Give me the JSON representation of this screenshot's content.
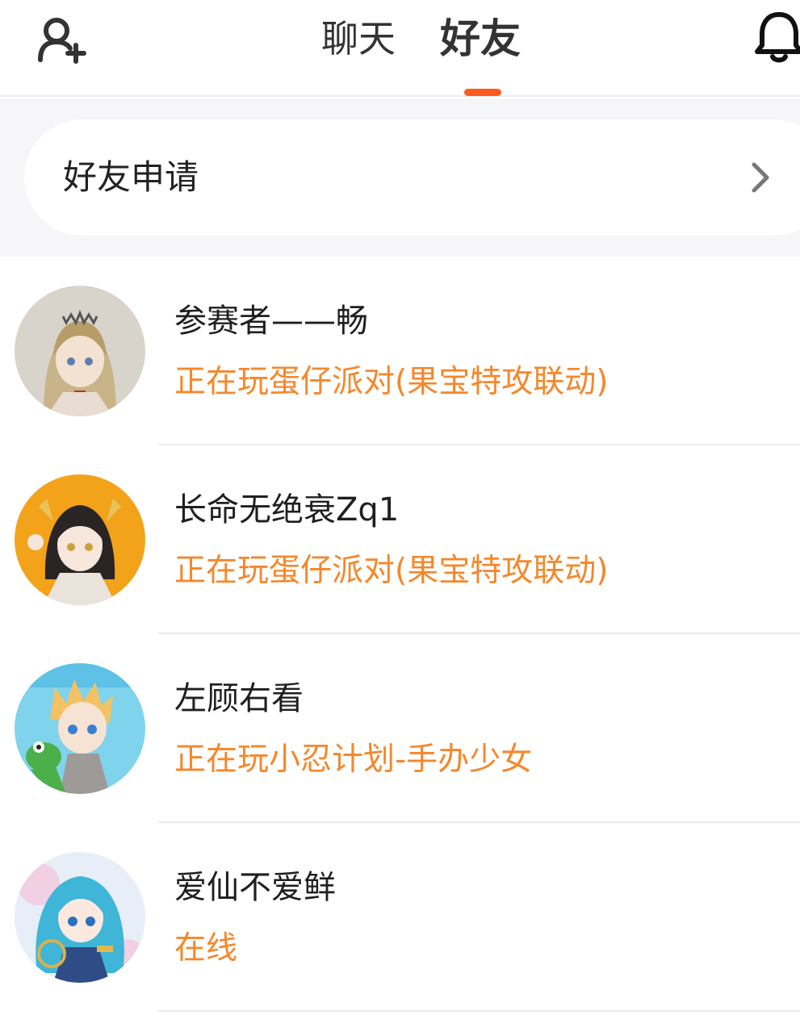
{
  "header": {
    "add_friend_icon": "add-user-icon",
    "tabs": [
      {
        "label": "聊天",
        "active": false
      },
      {
        "label": "好友",
        "active": true
      }
    ],
    "notification_icon": "bell-icon",
    "accent_color": "#ff5a1f"
  },
  "friend_requests": {
    "label": "好友申请",
    "icon": "chevron-right-icon"
  },
  "friends": [
    {
      "name": "参赛者——畅",
      "status": "正在玩蛋仔派对(果宝特攻联动)",
      "avatar": "anime-girl-blonde-maid-avatar"
    },
    {
      "name": "长命无绝衰Zq1",
      "status": "正在玩蛋仔派对(果宝特攻联动)",
      "avatar": "anime-girl-black-hair-orange-bg-avatar"
    },
    {
      "name": "左顾右看",
      "status": "正在玩小忍计划-手办少女",
      "avatar": "anime-boy-blonde-frog-avatar"
    },
    {
      "name": "爱仙不爱鲜",
      "status": "在线",
      "avatar": "anime-girl-cyan-hair-avatar"
    }
  ],
  "colors": {
    "status_text": "#f5872b",
    "name_text": "#1f1f1f",
    "band_background": "#f6f6f8"
  }
}
